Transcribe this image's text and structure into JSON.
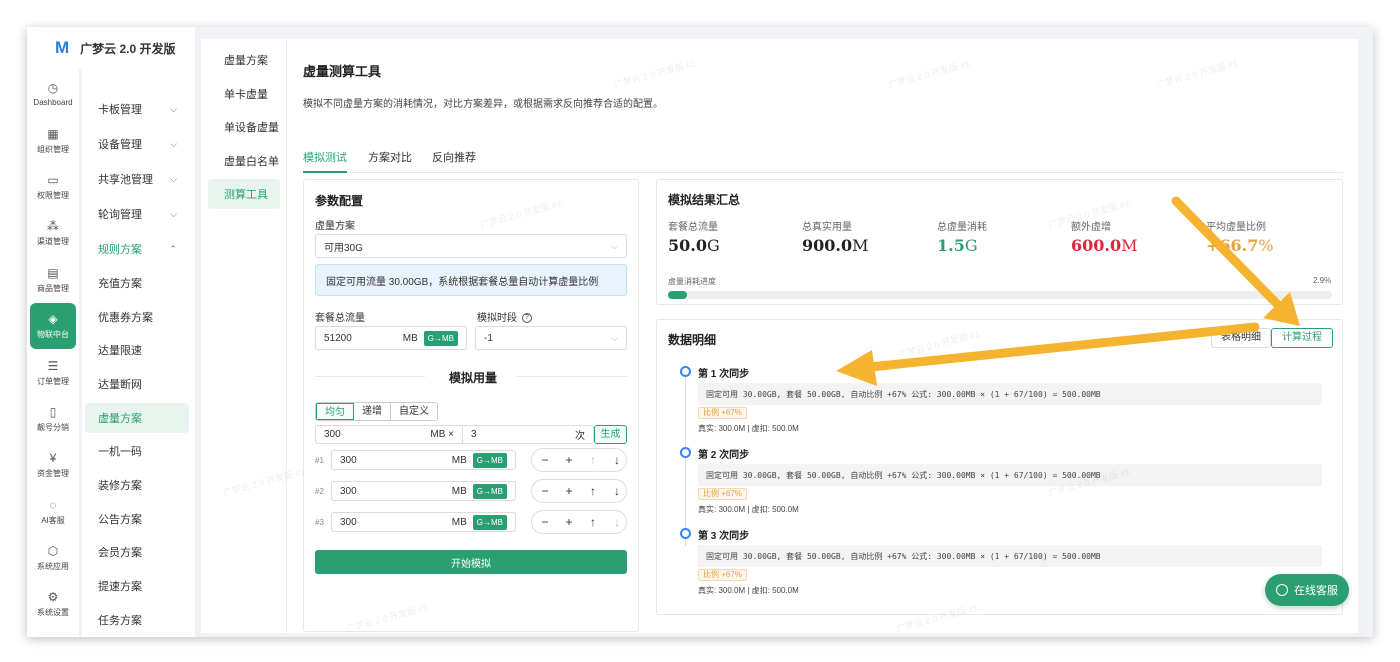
{
  "app": {
    "logo_mark": "M",
    "name": "广梦云 2.0 开发版"
  },
  "rail": [
    {
      "icon": "dashboard-icon",
      "glyph": "◷",
      "label": "Dashboard"
    },
    {
      "icon": "org-icon",
      "glyph": "▦",
      "label": "组织管理"
    },
    {
      "icon": "permission-icon",
      "glyph": "▭",
      "label": "权限管理"
    },
    {
      "icon": "channel-icon",
      "glyph": "⁂",
      "label": "渠道管理"
    },
    {
      "icon": "product-icon",
      "glyph": "▤",
      "label": "商品管理"
    },
    {
      "icon": "iot-icon",
      "glyph": "◈",
      "label": "物联中台",
      "active": true
    },
    {
      "icon": "order-icon",
      "glyph": "☰",
      "label": "订单管理"
    },
    {
      "icon": "phone-icon",
      "glyph": "▯",
      "label": "靓号分销"
    },
    {
      "icon": "money-icon",
      "glyph": "¥",
      "label": "资金管理"
    },
    {
      "icon": "ai-icon",
      "glyph": "◌",
      "label": "AI客服"
    },
    {
      "icon": "app-icon",
      "glyph": "⬡",
      "label": "系统应用"
    },
    {
      "icon": "settings-icon",
      "glyph": "⚙",
      "label": "系统设置"
    }
  ],
  "submenu": [
    {
      "label": "卡板管理",
      "chev": "⌵"
    },
    {
      "label": "设备管理",
      "chev": "⌵"
    },
    {
      "label": "共享池管理",
      "chev": "⌵"
    },
    {
      "label": "轮询管理",
      "chev": "⌵"
    },
    {
      "label": "规则方案",
      "chev": "⌃",
      "open": true
    },
    {
      "label": "充值方案"
    },
    {
      "label": "优惠券方案"
    },
    {
      "label": "达量限速"
    },
    {
      "label": "达量断网"
    },
    {
      "label": "虚量方案",
      "active": true
    },
    {
      "label": "一机一码"
    },
    {
      "label": "装修方案"
    },
    {
      "label": "公告方案"
    },
    {
      "label": "会员方案"
    },
    {
      "label": "提速方案"
    },
    {
      "label": "任务方案"
    }
  ],
  "tnav": [
    "虚量方案",
    "单卡虚量",
    "单设备虚量",
    "虚量白名单",
    "测算工具"
  ],
  "page": {
    "title": "虚量测算工具",
    "desc": "模拟不同虚量方案的消耗情况，对比方案差异，或根据需求反向推荐合适的配置。",
    "tabs": [
      "模拟测试",
      "方案对比",
      "反向推荐"
    ]
  },
  "params": {
    "title": "参数配置",
    "plan_label": "虚量方案",
    "plan_value": "可用30G",
    "plan_chev": "⌵",
    "info": "固定可用流量 30.00GB，系统根据套餐总量自动计算虚量比例",
    "total_label": "套餐总流量",
    "total_value": "51200",
    "total_unit": "MB",
    "convert": "G→MB",
    "period_label": "模拟时段",
    "period_help": "?",
    "period_value": "-1",
    "usage_title": "模拟用量",
    "modes": [
      "均匀",
      "递增",
      "自定义"
    ],
    "gen_amount": "300",
    "gen_unit": "MB ×",
    "gen_times": "3",
    "gen_times_unit": "次",
    "gen_button": "生成",
    "rows": [
      {
        "idx": "#1",
        "value": "300",
        "unit": "MB"
      },
      {
        "idx": "#2",
        "value": "300",
        "unit": "MB"
      },
      {
        "idx": "#3",
        "value": "300",
        "unit": "MB"
      }
    ],
    "ctrl_glyphs": {
      "minus": "−",
      "plus": "+",
      "up": "↑",
      "down": "↓"
    },
    "start": "开始模拟"
  },
  "summary": {
    "title": "模拟结果汇总",
    "stats": [
      {
        "label": "套餐总流量",
        "num": "50.0",
        "unit": "G",
        "color": "#222222"
      },
      {
        "label": "总真实用量",
        "num": "900.0",
        "unit": "M",
        "color": "#222222"
      },
      {
        "label": "总虚量消耗",
        "num": "1.5",
        "unit": "G",
        "color": "#2aa072"
      },
      {
        "label": "额外虚增",
        "num": "600.0",
        "unit": "M",
        "color": "#e0243a"
      },
      {
        "label": "平均虚量比例",
        "num": "+66.7",
        "unit": "%",
        "color": "#e6a23c"
      }
    ],
    "progress_label": "虚量消耗进度",
    "progress_pct": "2.9%",
    "progress_value": 0.029
  },
  "detail": {
    "title": "数据明细",
    "view_table": "表格明细",
    "view_calc": "计算过程",
    "steps": [
      {
        "title": "第 1 次同步",
        "formula": "固定可用 30.00GB, 套餐 50.00GB, 自动比例 +67% 公式: 300.00MB × (1 + 67/100) = 500.00MB",
        "badge": "比例 +67%",
        "meta": "真实: 300.0M | 虚扣: 500.0M"
      },
      {
        "title": "第 2 次同步",
        "formula": "固定可用 30.00GB, 套餐 50.00GB, 自动比例 +67% 公式: 300.00MB × (1 + 67/100) = 500.00MB",
        "badge": "比例 +67%",
        "meta": "真实: 300.0M | 虚扣: 500.0M"
      },
      {
        "title": "第 3 次同步",
        "formula": "固定可用 30.00GB, 套餐 50.00GB, 自动比例 +67% 公式: 300.00MB × (1 + 67/100) = 500.00MB",
        "badge": "比例 +67%",
        "meta": "真实: 300.0M | 虚扣: 500.0M"
      }
    ]
  },
  "chat": {
    "label": "在线客服"
  },
  "watermark": "广梦云 2.0 开发版 #1",
  "colors": {
    "accent": "#2aa072",
    "annotation_arrow": "#f5b330"
  }
}
